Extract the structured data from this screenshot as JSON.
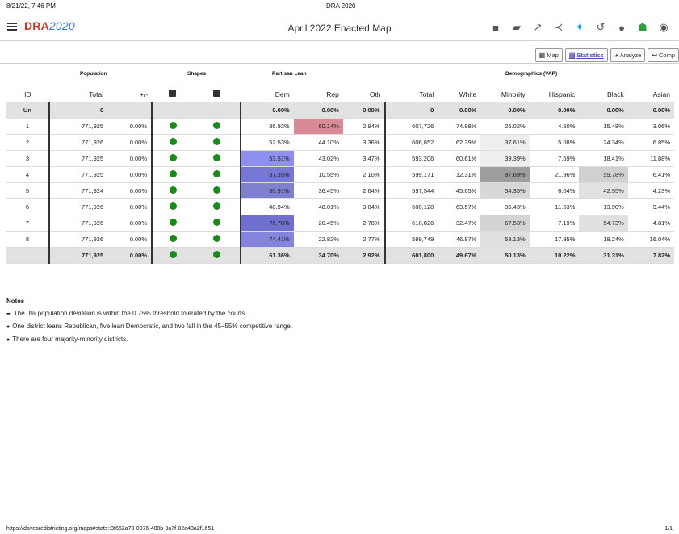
{
  "print_header": {
    "datetime": "8/21/22, 7:46 PM",
    "title": "DRA 2020"
  },
  "app": {
    "logo_main": "DRA",
    "logo_year": "2020",
    "title": "April 2022 Enacted Map"
  },
  "toolbar_icons": [
    "square-icon",
    "comment-icon",
    "expand-icon",
    "share-icon",
    "twitter-icon",
    "history-icon",
    "circle-icon",
    "user-icon",
    "account-icon"
  ],
  "tabs": [
    {
      "label": "Map",
      "icon": "map-icon",
      "active": false
    },
    {
      "label": "Statistics",
      "icon": "table-icon",
      "active": true
    },
    {
      "label": "Analyze",
      "icon": "pie-icon",
      "active": false
    },
    {
      "label": "Comp",
      "icon": "compare-icon",
      "active": false
    }
  ],
  "groups": {
    "population": "Population",
    "shapes": "Shapes",
    "partisan": "Partisan Lean",
    "demographics": "Demographics (VAP)"
  },
  "columns": {
    "id": "ID",
    "total": "Total",
    "dev": "+/-",
    "dem": "Dem",
    "rep": "Rep",
    "oth": "Oth",
    "vap_total": "Total",
    "white": "White",
    "minority": "Minority",
    "hispanic": "Hispanic",
    "black": "Black",
    "asian": "Asian"
  },
  "rows": [
    {
      "id": "Un",
      "total": "0",
      "dev": "",
      "dem": "0.00%",
      "rep": "0.00%",
      "oth": "0.00%",
      "vap_total": "0",
      "white": "0.00%",
      "minority": "0.00%",
      "hispanic": "0.00%",
      "black": "0.00%",
      "asian": "0.00%"
    },
    {
      "id": "1",
      "total": "771,925",
      "dev": "0.00%",
      "dem": "36.92%",
      "rep": "60.14%",
      "oth": "2.94%",
      "vap_total": "607,726",
      "white": "74.98%",
      "minority": "25.02%",
      "hispanic": "4.50%",
      "black": "15.48%",
      "asian": "3.06%"
    },
    {
      "id": "2",
      "total": "771,926",
      "dev": "0.00%",
      "dem": "52.53%",
      "rep": "44.10%",
      "oth": "3.36%",
      "vap_total": "606,852",
      "white": "62.39%",
      "minority": "37.61%",
      "hispanic": "5.08%",
      "black": "24.34%",
      "asian": "6.85%"
    },
    {
      "id": "3",
      "total": "771,925",
      "dev": "0.00%",
      "dem": "53.51%",
      "rep": "43.02%",
      "oth": "3.47%",
      "vap_total": "593,206",
      "white": "60.61%",
      "minority": "39.39%",
      "hispanic": "7.59%",
      "black": "18.41%",
      "asian": "11.88%"
    },
    {
      "id": "4",
      "total": "771,925",
      "dev": "0.00%",
      "dem": "87.35%",
      "rep": "10.55%",
      "oth": "2.10%",
      "vap_total": "599,171",
      "white": "12.31%",
      "minority": "87.69%",
      "hispanic": "21.96%",
      "black": "59.78%",
      "asian": "6.41%"
    },
    {
      "id": "5",
      "total": "771,924",
      "dev": "0.00%",
      "dem": "60.91%",
      "rep": "36.45%",
      "oth": "2.64%",
      "vap_total": "597,544",
      "white": "45.65%",
      "minority": "54.35%",
      "hispanic": "6.04%",
      "black": "42.95%",
      "asian": "4.23%"
    },
    {
      "id": "6",
      "total": "771,926",
      "dev": "0.00%",
      "dem": "48.94%",
      "rep": "48.01%",
      "oth": "3.04%",
      "vap_total": "600,128",
      "white": "63.57%",
      "minority": "36.43%",
      "hispanic": "11.63%",
      "black": "13.90%",
      "asian": "9.44%"
    },
    {
      "id": "7",
      "total": "771,926",
      "dev": "0.00%",
      "dem": "76.78%",
      "rep": "20.45%",
      "oth": "2.78%",
      "vap_total": "610,826",
      "white": "32.47%",
      "minority": "67.53%",
      "hispanic": "7.19%",
      "black": "54.73%",
      "asian": "4.81%"
    },
    {
      "id": "8",
      "total": "771,926",
      "dev": "0.00%",
      "dem": "74.41%",
      "rep": "22.82%",
      "oth": "2.77%",
      "vap_total": "599,749",
      "white": "46.87%",
      "minority": "53.13%",
      "hispanic": "17.95%",
      "black": "18.24%",
      "asian": "16.04%"
    },
    {
      "id": "",
      "total": "771,925",
      "dev": "0.00%",
      "dem": "61.36%",
      "rep": "34.70%",
      "oth": "2.92%",
      "vap_total": "601,800",
      "white": "49.67%",
      "minority": "50.13%",
      "hispanic": "10.22%",
      "black": "31.31%",
      "asian": "7.82%"
    }
  ],
  "cell_colors": {
    "1": {
      "rep": "#d98a97"
    },
    "2": {
      "minority": "#eeeeee"
    },
    "3": {
      "dem": "#8f8ff0",
      "minority": "#eeeeee"
    },
    "4": {
      "dem": "#7777d6",
      "minority": "#9e9e9e",
      "black": "#d0d0d0"
    },
    "5": {
      "dem": "#8080d0",
      "minority": "#d8d8d8",
      "black": "#e2e2e2"
    },
    "7": {
      "dem": "#7070d0",
      "minority": "#d3d3d3",
      "black": "#e0e0e0"
    },
    "8": {
      "dem": "#8484dc",
      "minority": "#e0e0e0"
    }
  },
  "notes": {
    "heading": "Notes",
    "items": [
      "The 0% population deviation is within the 0.75% threshold tolerated by the courts.",
      "One district leans Republican, five lean Democratic, and two fall in the 45–55% competitive range.",
      "There are four majority-minority districts."
    ]
  },
  "footer": {
    "url": "https://davesredistricting.org/maps#stats::3f662a78-0876-488b-9a7f-02a48a2f1651",
    "page": "1/1"
  }
}
